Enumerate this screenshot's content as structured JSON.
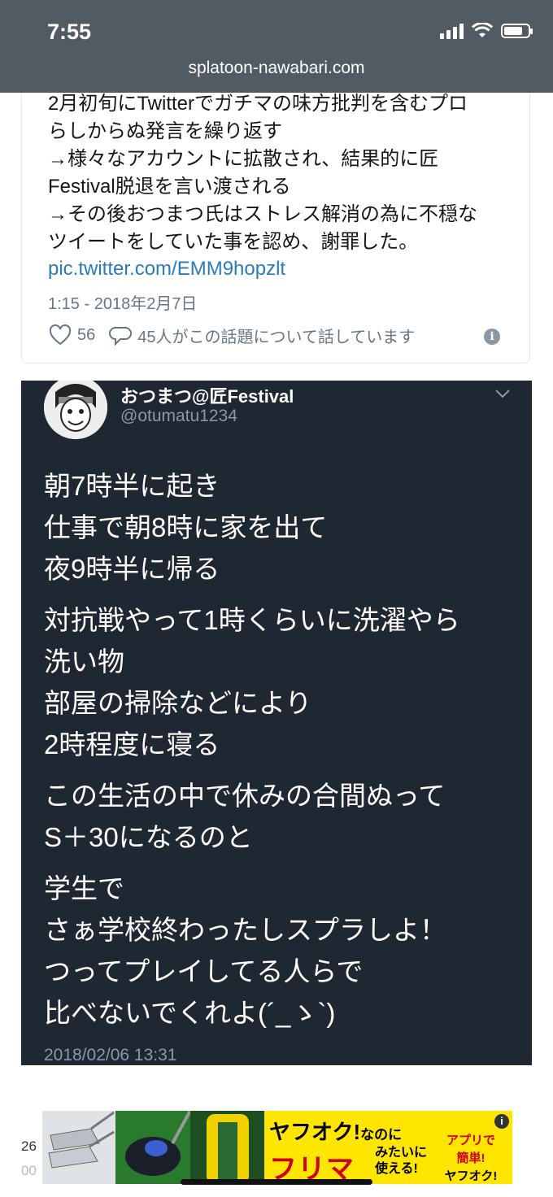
{
  "status_bar": {
    "time": "7:55"
  },
  "browser": {
    "url": "splatoon-nawabari.com"
  },
  "tweet_card": {
    "lines": [
      "2月初旬にTwitterでガチマの味方批判を含むプロ",
      "らしからぬ発言を繰り返す",
      "→様々なアカウントに拡散され、結果的に匠",
      "Festival脱退を言い渡される",
      "→その後おつまつ氏はストレス解消の為に不穏な",
      "ツイートをしていた事を認め、謝罪した。"
    ],
    "link": "pic.twitter.com/EMM9hopzlt",
    "date": "1:15 - 2018年2月7日",
    "likes": "56",
    "conversation": "45人がこの話題について話しています"
  },
  "screenshot_tweet": {
    "display_name": "おつまつ@匠Festival",
    "handle": "@otumatu1234",
    "paragraphs": [
      [
        "朝7時半に起き",
        "仕事で朝8時に家を出て",
        "夜9時半に帰る"
      ],
      [
        "対抗戦やって1時くらいに洗濯やら",
        "洗い物",
        "部屋の掃除などにより",
        "2時程度に寝る"
      ],
      [
        "この生活の中で休みの合間ぬって",
        "S＋30になるのと"
      ],
      [
        "学生で",
        "さぁ学校終わったしスプラしよ！",
        "つってプレイしてる人らで",
        "比べないでくれよ(´_ゝ`)"
      ]
    ],
    "timestamp": "2018/02/06 13:31"
  },
  "ad": {
    "brand": "ヤフオク!",
    "brand_suffix": "なのに",
    "headline": "フリマ",
    "side_text": [
      "みたいに",
      "使える!"
    ],
    "right_text": [
      "アプリで",
      "簡単!",
      "ヤフオク!"
    ],
    "behind_text": [
      "26",
      "00"
    ]
  },
  "colors": {
    "status_bg": "#525a64",
    "dark_tweet_bg": "#1f2733",
    "link": "#2b7bb9",
    "ad_bg": "#ffe600"
  }
}
